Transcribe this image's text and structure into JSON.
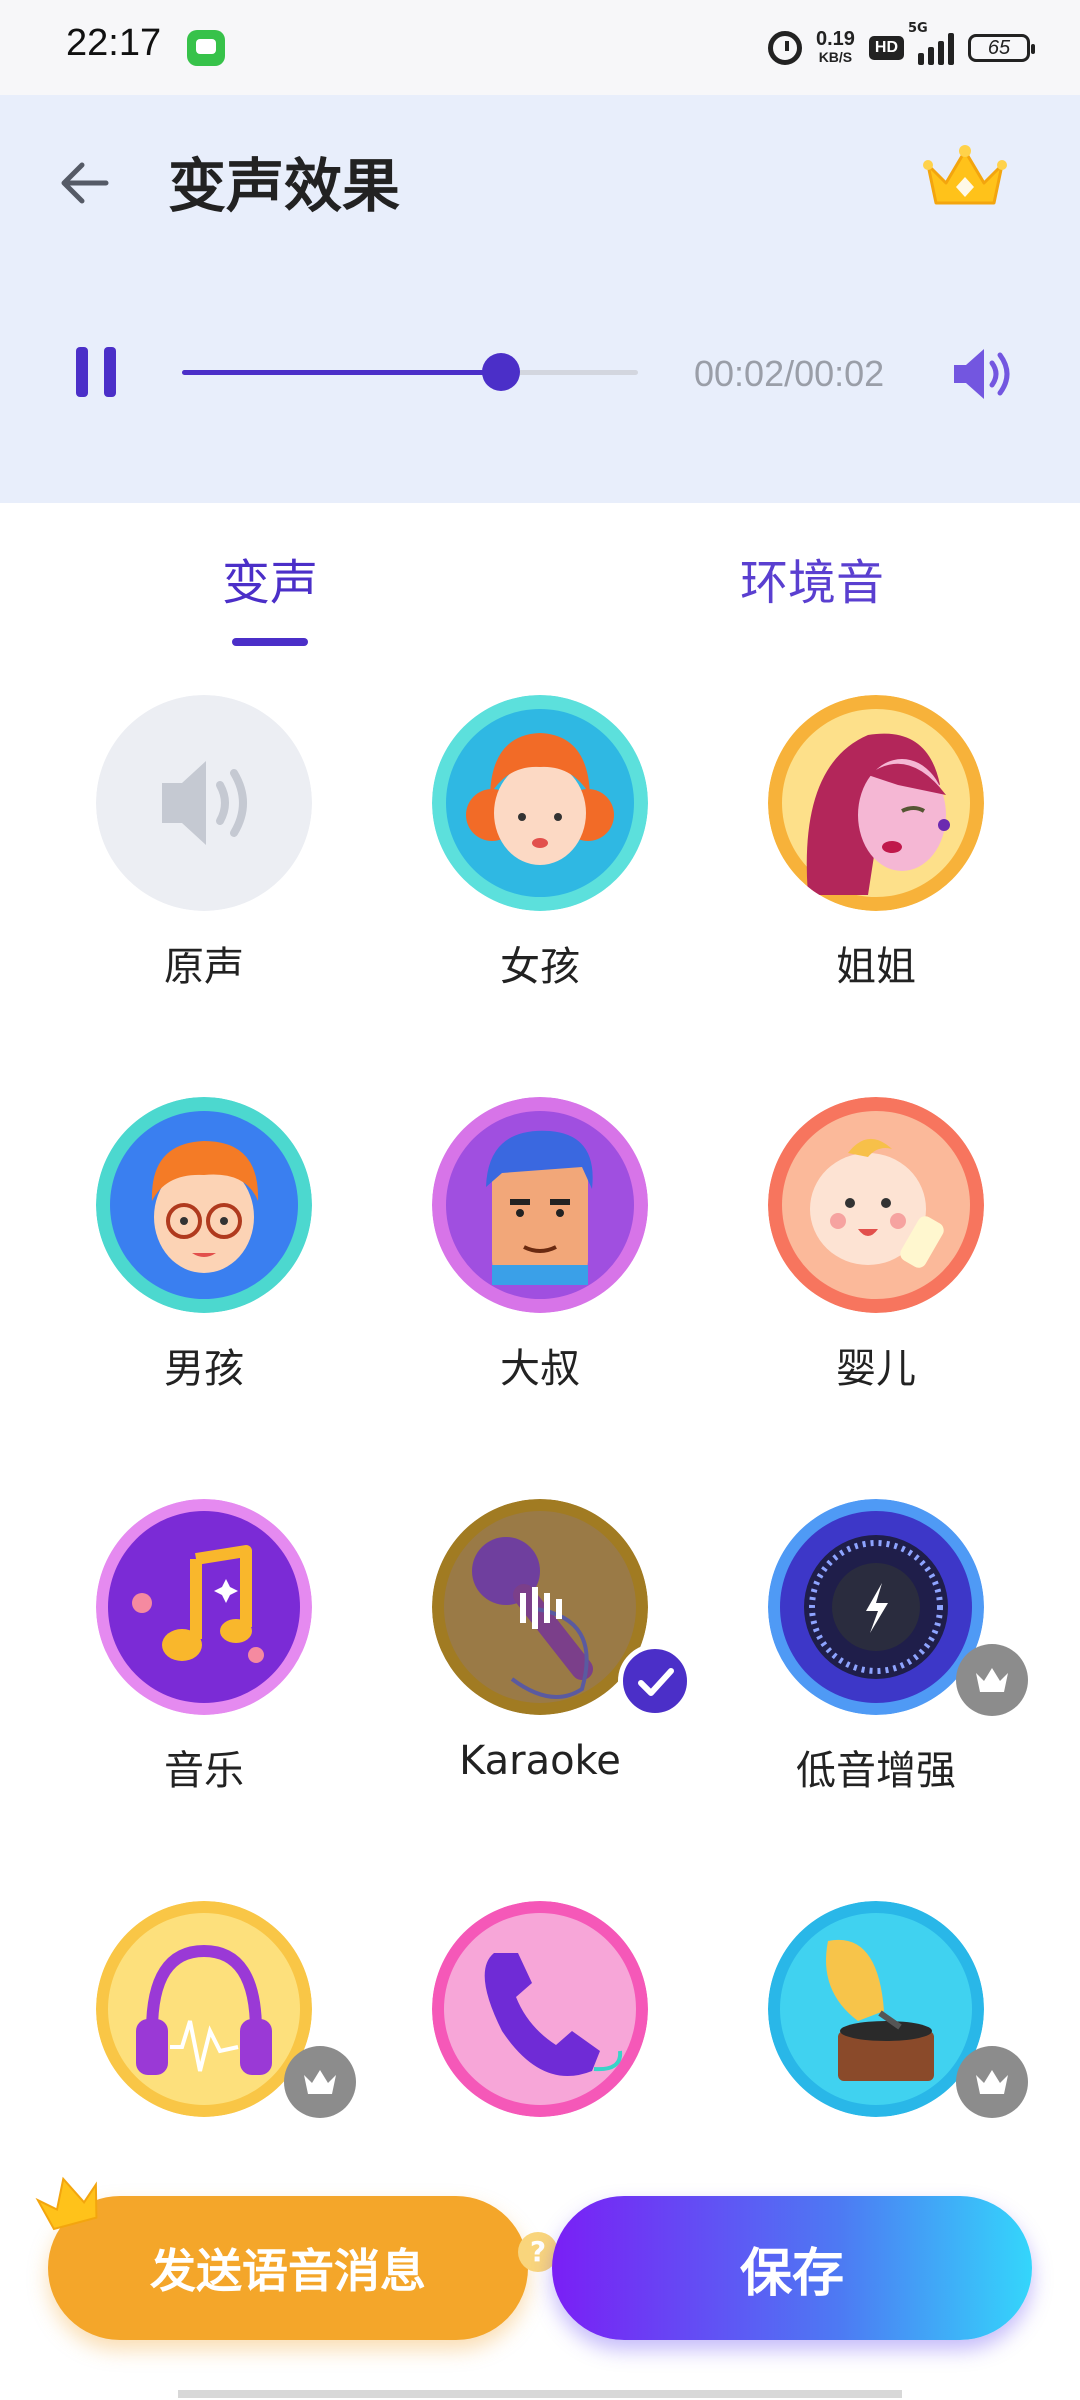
{
  "status_bar": {
    "time": "22:17",
    "net_speed_value": "0.19",
    "net_speed_unit": "KB/S",
    "hd_label": "HD",
    "network_label": "5G",
    "battery": "65"
  },
  "header": {
    "title": "变声效果"
  },
  "player": {
    "time_label": "00:02/00:02",
    "progress_fraction": 0.7
  },
  "tabs": [
    {
      "label": "变声",
      "selected": true
    },
    {
      "label": "环境音",
      "selected": false
    }
  ],
  "effects": [
    {
      "label": "原声",
      "icon": "speaker-icon"
    },
    {
      "label": "女孩",
      "icon": "girl-avatar"
    },
    {
      "label": "姐姐",
      "icon": "sister-avatar"
    },
    {
      "label": "男孩",
      "icon": "boy-avatar"
    },
    {
      "label": "大叔",
      "icon": "uncle-avatar"
    },
    {
      "label": "婴儿",
      "icon": "baby-avatar"
    },
    {
      "label": "音乐",
      "icon": "music-note-icon"
    },
    {
      "label": "Karaoke",
      "icon": "microphone-icon",
      "selected": true
    },
    {
      "label": "低音增强",
      "icon": "bass-knob-icon",
      "vip": true
    },
    {
      "label": "",
      "icon": "headphones-icon",
      "vip": true
    },
    {
      "label": "",
      "icon": "telephone-icon"
    },
    {
      "label": "",
      "icon": "gramophone-icon",
      "vip": true
    }
  ],
  "buttons": {
    "send_label": "发送语音消息",
    "help_label": "?",
    "save_label": "保存"
  },
  "colors": {
    "accent": "#4b2fc8",
    "header_bg": "#e8eefb",
    "send_button": "#f4a62a",
    "vip_badge": "#8c8c8c"
  }
}
